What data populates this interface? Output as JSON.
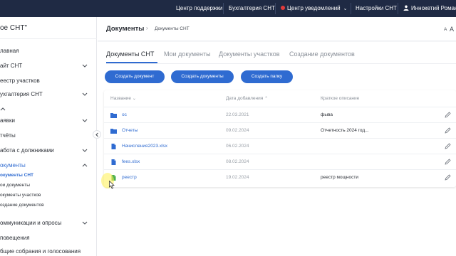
{
  "topbar": {
    "support": "Центр поддержки",
    "accounting": "Бухгалтерия СНТ",
    "notifications": "Центр уведомлений",
    "settings": "Настройки СНТ",
    "user": "Иннокетий Романо"
  },
  "sidebar": {
    "brand": "ое СНТ\"",
    "items": {
      "main": "лавная",
      "site": "айт СНТ",
      "registry": "еестр участков",
      "accounting": "ухгалтерия СНТ",
      "requests": "аявки",
      "reports": "тчёты",
      "debtors": "абота с должниками",
      "documents": "окументы",
      "communications": "оммуникации и опросы",
      "alerts": "повещения",
      "meetings": "бщие собрания и голосования"
    },
    "doc_subitems": [
      "окументы СНТ",
      "ои документы",
      "окументы участков",
      "оздание документов"
    ]
  },
  "breadcrumb": {
    "title": "Документы",
    "current": "Документы СНТ",
    "font_small": "A",
    "font_large": "A"
  },
  "tabs": [
    "Документы СНТ",
    "Мои документы",
    "Документы участков",
    "Создание документов"
  ],
  "buttons": {
    "create_document": "Создать документ",
    "create_documents": "Создать документы",
    "create_folder": "Создать папку"
  },
  "table": {
    "headers": {
      "name": "Название",
      "date": "Дата добавления",
      "desc": "Краткое описание"
    },
    "rows": [
      {
        "type": "folder",
        "name": "ос",
        "date": "22.03.2021",
        "desc": "фыва"
      },
      {
        "type": "folder",
        "name": "Отчеты",
        "date": "09.02.2024",
        "desc": "Отчетность 2024 год..."
      },
      {
        "type": "file",
        "name": "Начисления2023.xlsx",
        "date": "06.02.2024",
        "desc": ""
      },
      {
        "type": "file",
        "name": "fees.xlsx",
        "date": "08.02.2024",
        "desc": ""
      },
      {
        "type": "file-green",
        "name": "реестр",
        "date": "19.02.2024",
        "desc": "реестр мощности"
      }
    ]
  },
  "colors": {
    "topbar_bg": "#1f2a44",
    "accent": "#2f6bd1",
    "notif_red": "#e23b3b",
    "folder_blue": "#2f6bd1",
    "file_green": "#4caf50"
  }
}
